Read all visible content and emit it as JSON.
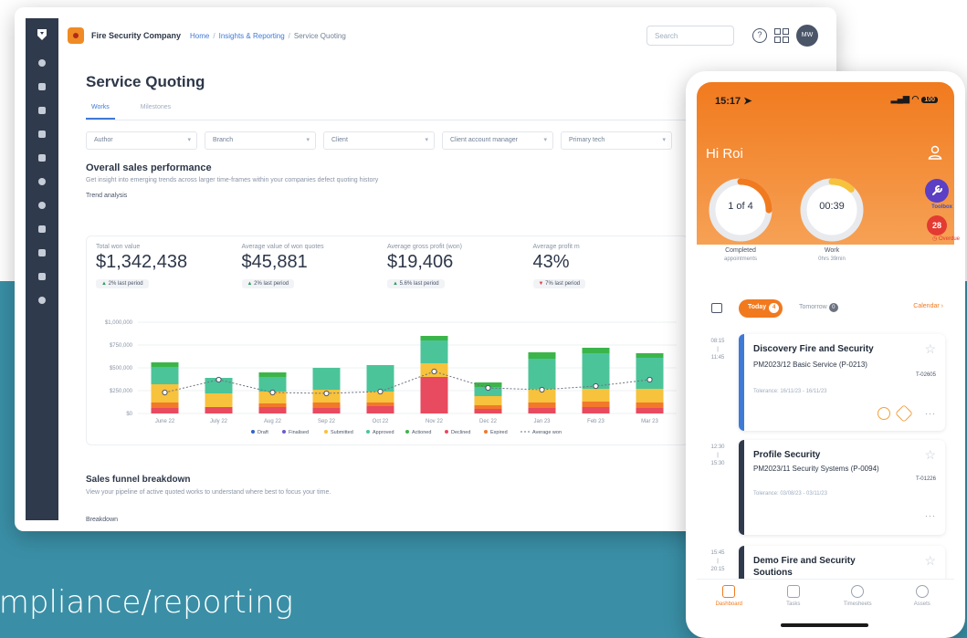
{
  "caption": "ompliance/reporting",
  "desktop": {
    "brand": "Fire Security Company",
    "breadcrumb": [
      "Home",
      "Insights & Reporting",
      "Service Quoting"
    ],
    "search_placeholder": "Search",
    "help_glyph": "?",
    "avatar_initials": "MW",
    "page_title": "Service Quoting",
    "tabs": [
      "Works",
      "Milestones"
    ],
    "filters": [
      "Author",
      "Branch",
      "Client",
      "Client account manager",
      "Primary tech"
    ],
    "overall_title": "Overall sales performance",
    "overall_desc": "Get insight into emerging trends across larger time-frames within your companies defect quoting history",
    "trend_label": "Trend analysis",
    "kpis": [
      {
        "label": "Total won value",
        "value": "$1,342,438",
        "delta": "2% last period",
        "dir": "up"
      },
      {
        "label": "Average value of won quotes",
        "value": "$45,881",
        "delta": "2% last period",
        "dir": "up"
      },
      {
        "label": "Average gross profit (won)",
        "value": "$19,406",
        "delta": "5.6% last period",
        "dir": "up"
      },
      {
        "label": "Average profit m",
        "value": "43%",
        "delta": "7% last period",
        "dir": "down"
      }
    ],
    "funnel_title": "Sales funnel breakdown",
    "funnel_desc": "View your pipeline of active quoted works to understand where best to focus your time.",
    "funnel_sub": "Breakdown"
  },
  "chart_data": {
    "type": "bar",
    "stacked": true,
    "categories": [
      "June 22",
      "July 22",
      "Aug 22",
      "Sep 22",
      "Oct 22",
      "Nov 22",
      "Dec 22",
      "Jan 23",
      "Feb 23",
      "Mar 23"
    ],
    "y_tick_labels": [
      "$1,000,000",
      "$750,000",
      "$500,000",
      "$250,000",
      "$0"
    ],
    "ylim": [
      0,
      1000000
    ],
    "series": [
      {
        "name": "Draft",
        "color": "#2f63c7",
        "values": [
          0,
          0,
          0,
          0,
          0,
          0,
          0,
          0,
          0,
          0
        ]
      },
      {
        "name": "Finalised",
        "color": "#6a5acd",
        "values": [
          0,
          0,
          0,
          0,
          0,
          0,
          0,
          0,
          0,
          0
        ]
      },
      {
        "name": "Declined",
        "color": "#e84a5f",
        "values": [
          60000,
          70000,
          70000,
          60000,
          80000,
          400000,
          50000,
          60000,
          70000,
          60000
        ]
      },
      {
        "name": "Expired",
        "color": "#f2782a",
        "values": [
          60000,
          0,
          40000,
          60000,
          40000,
          0,
          40000,
          60000,
          60000,
          60000
        ]
      },
      {
        "name": "Submitted",
        "color": "#f7c23c",
        "values": [
          200000,
          150000,
          130000,
          140000,
          120000,
          150000,
          100000,
          150000,
          140000,
          150000
        ]
      },
      {
        "name": "Approved",
        "color": "#4cc49a",
        "values": [
          190000,
          170000,
          160000,
          240000,
          290000,
          250000,
          100000,
          330000,
          390000,
          340000
        ]
      },
      {
        "name": "Actioned",
        "color": "#3bb54a",
        "values": [
          50000,
          0,
          50000,
          0,
          0,
          50000,
          50000,
          70000,
          60000,
          50000
        ]
      }
    ],
    "line_series": {
      "name": "Average won",
      "values": [
        230000,
        370000,
        230000,
        220000,
        240000,
        460000,
        280000,
        260000,
        300000,
        370000
      ]
    },
    "legend": [
      "Draft",
      "Finalised",
      "Submitted",
      "Approved",
      "Actioned",
      "Declined",
      "Expired",
      "Average won"
    ],
    "legend_position": "bottom",
    "grid": true
  },
  "phone": {
    "time": "15:17",
    "battery": "100",
    "greeting": "Hi Roi",
    "ring1_text": "1 of 4",
    "ring1_cap": "Completed",
    "ring1_sub": "appointments",
    "ring2_text": "00:39",
    "ring2_cap": "Work",
    "ring2_sub": "0hrs 39min",
    "toolbox_label": "Toolbox",
    "overdue_count": "28",
    "overdue_label": "Overdue",
    "today_label": "Today",
    "today_count": "4",
    "tomorrow_label": "Tomorrow",
    "tomorrow_count": "0",
    "calendar_label": "Calendar",
    "appointments": [
      {
        "start": "08:15",
        "end": "11:45",
        "title": "Discovery Fire and Security",
        "sub": "PM2023/12 Basic Service (P-0213)",
        "tolerance": "Tolerance: 16/11/23 - 16/11/23",
        "code": "T-02605",
        "color": "#3f7ad6"
      },
      {
        "start": "12:30",
        "end": "15:30",
        "title": "Profile Security",
        "sub": "PM2023/11 Security Systems (P-0094)",
        "tolerance": "Tolerance: 03/08/23 - 03/11/23",
        "code": "T-01226",
        "color": "#2f3a4c"
      },
      {
        "start": "15:45",
        "end": "20:15",
        "title": "Demo Fire and Security Soutions",
        "sub": "",
        "tolerance": "",
        "code": "",
        "color": "#2f3a4c"
      }
    ],
    "more_glyph": "···",
    "nav": [
      "Dashboard",
      "Tasks",
      "Timesheets",
      "Assets"
    ]
  }
}
